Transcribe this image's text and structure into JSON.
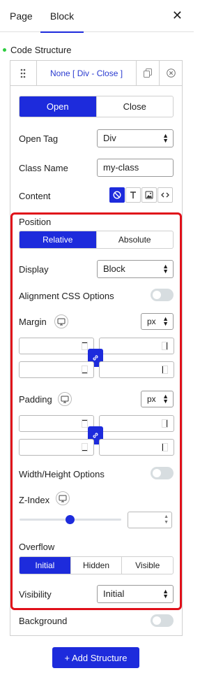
{
  "tabs": [
    {
      "label": "Page"
    },
    {
      "label": "Block"
    }
  ],
  "close_icon": "close-icon",
  "tree": {
    "title": "Code Structure"
  },
  "structure": {
    "label": "None [ Div - Close ]"
  },
  "tag_mode": {
    "options": [
      "Open",
      "Close"
    ],
    "selected": "Open"
  },
  "open_tag": {
    "label": "Open Tag",
    "value": "Div"
  },
  "class_name": {
    "label": "Class Name",
    "value": "my-class"
  },
  "content": {
    "label": "Content",
    "types": [
      "none-icon",
      "text-icon",
      "image-icon",
      "code-icon"
    ],
    "selected": "none-icon"
  },
  "position": {
    "label": "Position",
    "options": [
      "Relative",
      "Absolute"
    ],
    "selected": "Relative"
  },
  "display": {
    "label": "Display",
    "value": "Block"
  },
  "alignment": {
    "label": "Alignment CSS Options",
    "enabled": false
  },
  "margin": {
    "label": "Margin",
    "unit": "px",
    "values": [
      "",
      "",
      "",
      ""
    ]
  },
  "padding": {
    "label": "Padding",
    "unit": "px",
    "values": [
      "",
      "",
      "",
      ""
    ]
  },
  "width_height": {
    "label": "Width/Height Options",
    "enabled": false
  },
  "z_index": {
    "label": "Z-Index",
    "slider_fraction": 0.49,
    "value": ""
  },
  "overflow": {
    "label": "Overflow",
    "options": [
      "Initial",
      "Hidden",
      "Visible"
    ],
    "selected": "Initial"
  },
  "visibility": {
    "label": "Visibility",
    "value": "Initial"
  },
  "background": {
    "label": "Background",
    "enabled": false
  },
  "add_button": {
    "label": "+ Add Structure"
  },
  "colors": {
    "accent": "#1d2bdc",
    "highlight": "#e0101a",
    "toggle_off": "#d7dde0"
  }
}
